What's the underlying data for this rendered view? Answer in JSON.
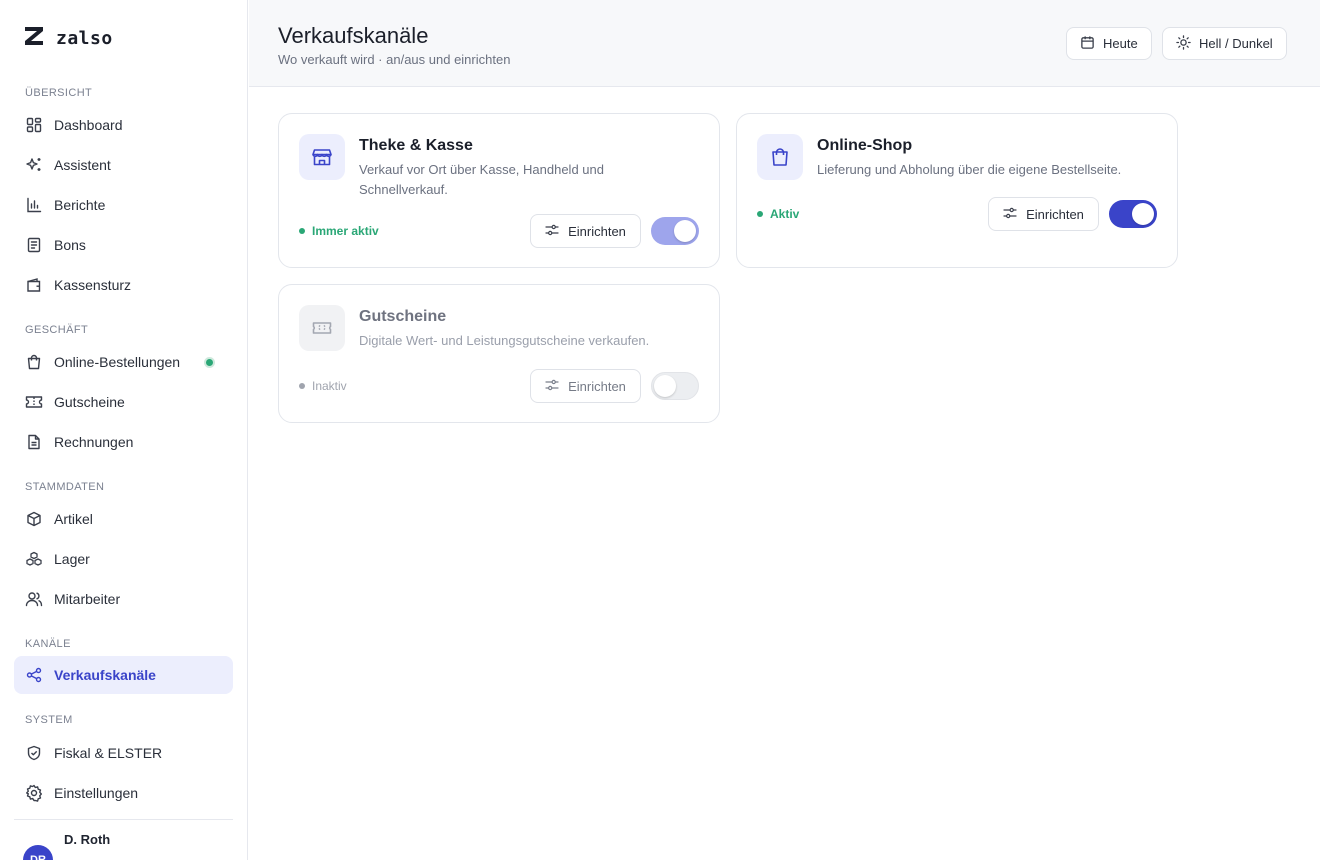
{
  "brand": {
    "name": "zalso"
  },
  "sidebar": {
    "sections": [
      {
        "label": "ÜBERSICHT"
      },
      {
        "label": "GESCHÄFT"
      },
      {
        "label": "STAMMDATEN"
      },
      {
        "label": "KANÄLE"
      },
      {
        "label": "SYSTEM"
      }
    ],
    "items": [
      {
        "label": "Dashboard",
        "icon": "grid-icon"
      },
      {
        "label": "Assistent",
        "icon": "sparkle-icon"
      },
      {
        "label": "Berichte",
        "icon": "bar-chart-icon"
      },
      {
        "label": "Bons",
        "icon": "receipt-icon"
      },
      {
        "label": "Kassensturz",
        "icon": "wallet-icon"
      },
      {
        "label": "Online-Bestellungen",
        "icon": "shopping-bag-icon",
        "status": "online"
      },
      {
        "label": "Gutscheine",
        "icon": "ticket-icon"
      },
      {
        "label": "Rechnungen",
        "icon": "document-icon"
      },
      {
        "label": "Artikel",
        "icon": "box-icon"
      },
      {
        "label": "Lager",
        "icon": "boxes-icon"
      },
      {
        "label": "Mitarbeiter",
        "icon": "users-icon"
      },
      {
        "label": "Verkaufskanäle",
        "icon": "share-icon",
        "active": true
      },
      {
        "label": "Fiskal & ELSTER",
        "icon": "shield-check-icon"
      },
      {
        "label": "Einstellungen",
        "icon": "gear-icon"
      }
    ],
    "user": {
      "name": "D. Roth",
      "initials": "DR"
    }
  },
  "header": {
    "title": "Verkaufskanäle",
    "subtitle": "Wo verkauft wird · an/aus und einrichten",
    "today_label": "Heute",
    "theme_label": "Hell / Dunkel"
  },
  "channels": [
    {
      "title": "Theke & Kasse",
      "description": "Verkauf vor Ort über Kasse, Handheld und Schnellverkauf.",
      "status": "Immer aktiv",
      "setup_label": "Einrichten",
      "enabled": true,
      "locked": true,
      "icon": "store-icon"
    },
    {
      "title": "Online-Shop",
      "description": "Lieferung und Abholung über die eigene Bestellseite.",
      "status": "Aktiv",
      "setup_label": "Einrichten",
      "enabled": true,
      "locked": false,
      "icon": "shopping-bag-icon"
    },
    {
      "title": "Gutscheine",
      "description": "Digitale Wert- und Leistungsgutscheine verkaufen.",
      "status": "Inaktiv",
      "setup_label": "Einrichten",
      "enabled": false,
      "locked": false,
      "icon": "ticket-icon"
    }
  ],
  "colors": {
    "accent": "#3a44c9",
    "accent_soft": "#9ea5ec",
    "success": "#2aa776",
    "inactive": "#a0a4ae"
  }
}
